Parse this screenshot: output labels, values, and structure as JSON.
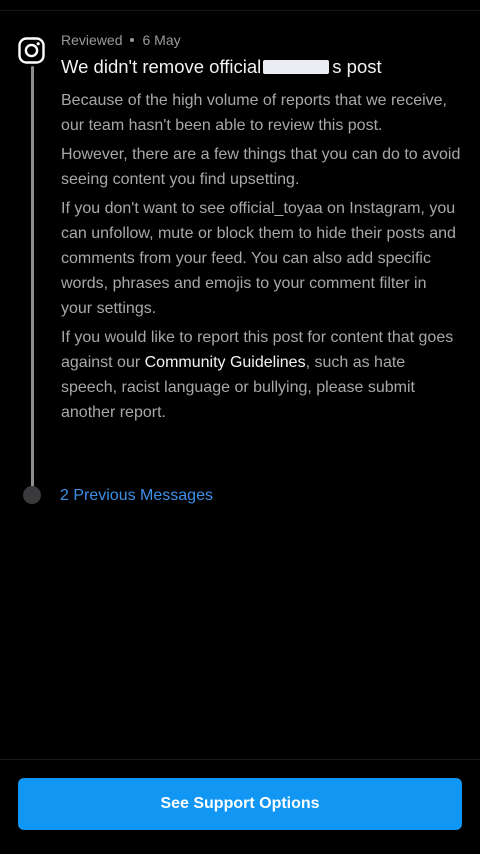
{
  "notice": {
    "status": "Reviewed",
    "date": "6 May",
    "title_start": "We didn't remove official",
    "title_end": "s post"
  },
  "body": {
    "p1": "Because of the high volume of reports that we receive, our team hasn't been able to review this post.",
    "p2": "However, there are a few things that you can do to avoid seeing content you find upsetting.",
    "p3": "If you don't want to see official_toyaa on Instagram, you can unfollow, mute or block them to hide their posts and comments from your feed. You can also add specific words, phrases and emojis to your comment filter in your settings.",
    "p4_before": "If you would like to report this post for content that goes against our ",
    "p4_link": "Community Guidelines",
    "p4_after": ", such as hate speech, racist language or bullying, please submit another report."
  },
  "timeline": {
    "previous_messages": "2 Previous Messages"
  },
  "footer": {
    "support_button": "See Support Options"
  },
  "icons": {
    "app": "instagram-icon"
  },
  "colors": {
    "background": "#000000",
    "accent_link": "#3d8fe6",
    "button": "#1196f4"
  }
}
